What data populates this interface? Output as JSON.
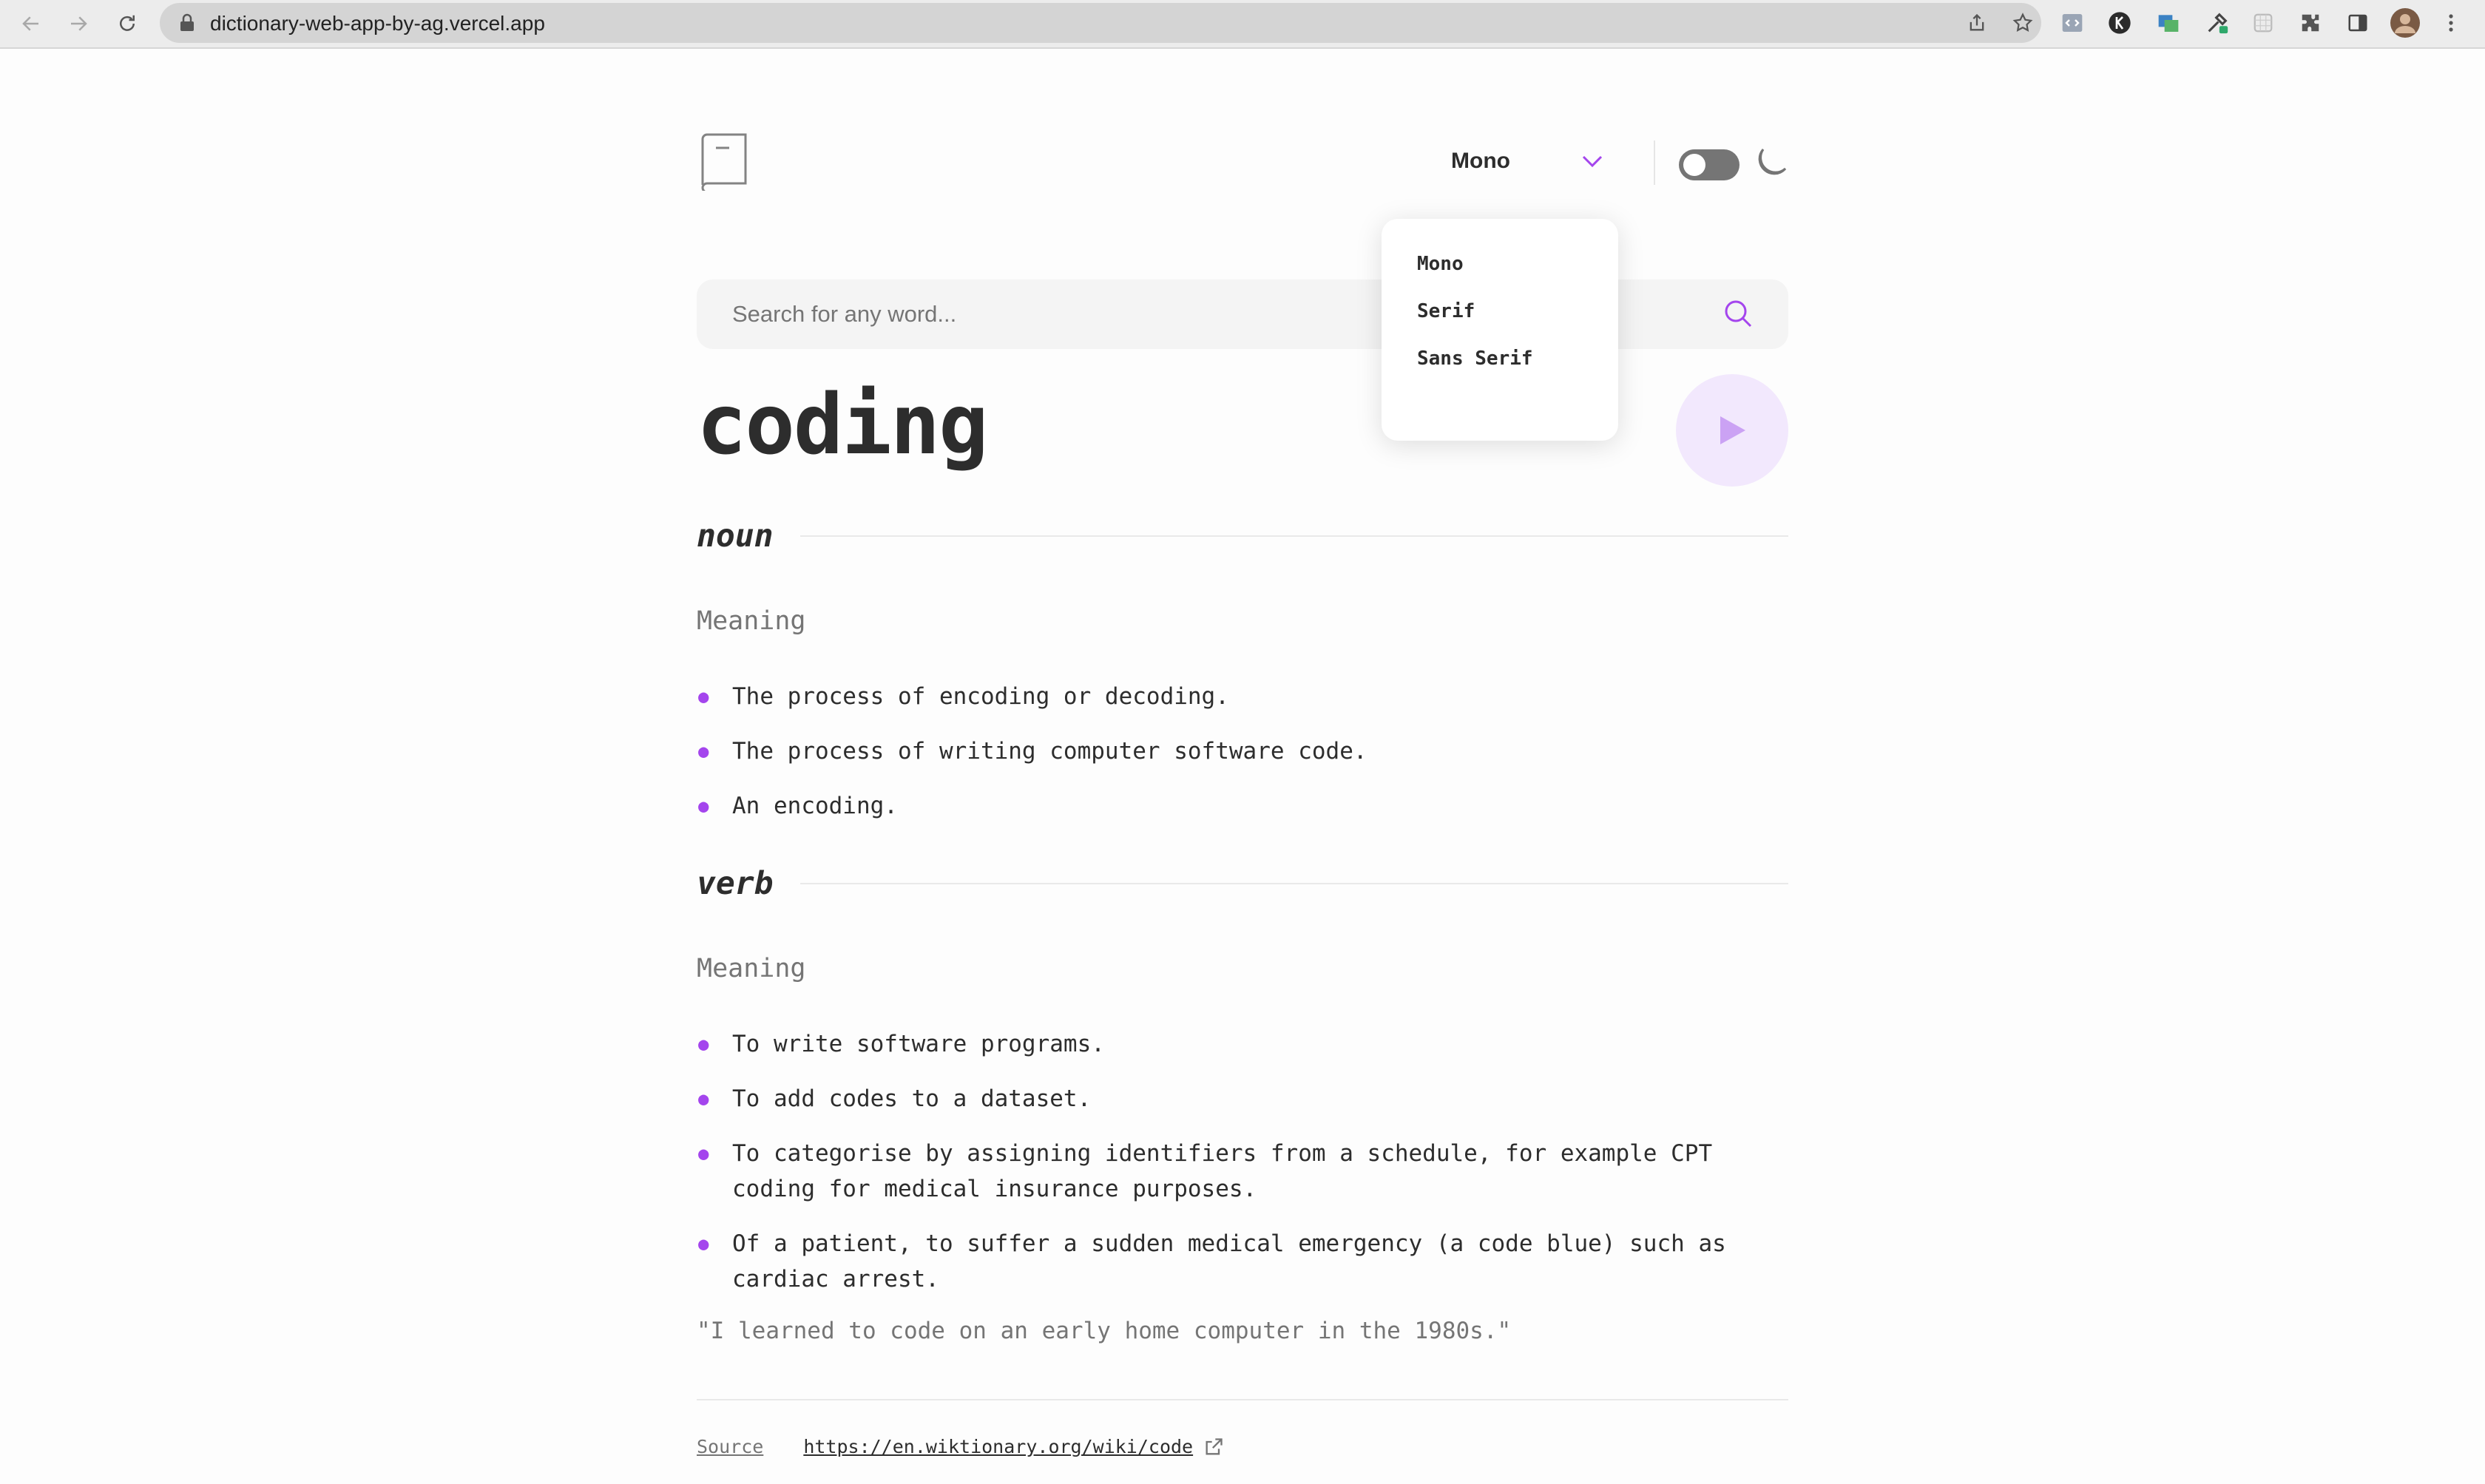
{
  "browser": {
    "url": "dictionary-web-app-by-ag.vercel.app"
  },
  "header": {
    "font_selected": "Mono",
    "theme_toggle": "off"
  },
  "font_menu": {
    "options": [
      "Mono",
      "Serif",
      "Sans Serif"
    ]
  },
  "search": {
    "placeholder": "Search for any word..."
  },
  "entry": {
    "word": "coding",
    "meanings": [
      {
        "part_of_speech": "noun",
        "heading": "Meaning",
        "definitions": [
          "The process of encoding or decoding.",
          "The process of writing computer software code.",
          "An encoding."
        ]
      },
      {
        "part_of_speech": "verb",
        "heading": "Meaning",
        "definitions": [
          "To write software programs.",
          "To add codes to a dataset.",
          "To categorise by assigning identifiers from a schedule, for example CPT coding for medical insurance purposes.",
          "Of a patient, to suffer a sudden medical emergency (a code blue) such as cardiac arrest."
        ],
        "example": "\"I learned to code on an early home computer in the 1980s.\""
      }
    ]
  },
  "source": {
    "label": "Source",
    "url": "https://en.wiktionary.org/wiki/code"
  },
  "colors": {
    "accent": "#a445ed",
    "text": "#2d2d2d",
    "muted": "#757575"
  }
}
